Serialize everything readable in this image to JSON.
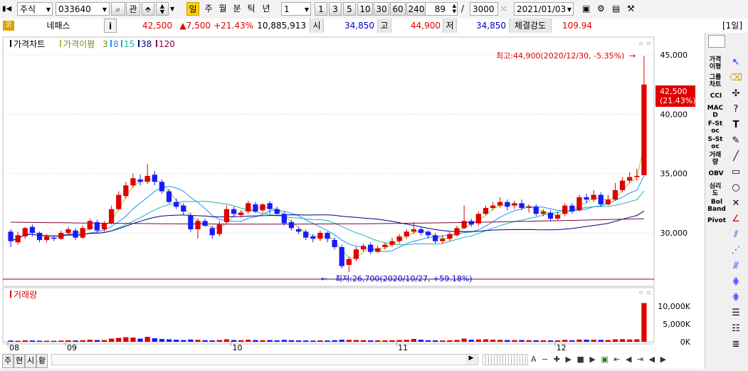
{
  "toolbar": {
    "market": "주식",
    "code": "033640",
    "search_icon": "magnifier-icon",
    "related": "관",
    "periods": [
      "일",
      "주",
      "월",
      "분",
      "틱",
      "년"
    ],
    "selected_period": "일",
    "interval_value": "1",
    "interval_buttons": [
      "1",
      "3",
      "5",
      "10",
      "30",
      "60",
      "240"
    ],
    "count_value": "89",
    "slash": "/",
    "total_count": "3000",
    "date": "2021/01/03"
  },
  "quote": {
    "market_short": "코",
    "name": "네패스",
    "info_label": "i",
    "price": "42,500",
    "change": "▲7,500",
    "change_pct": "+21.43%",
    "volume": "10,885,913",
    "open_label": "시",
    "open": "34,850",
    "high_label": "고",
    "high": "44,900",
    "low_label": "저",
    "low": "34,850",
    "strength_label": "체결강도",
    "strength": "109.94",
    "period_label": "[1일]"
  },
  "legend": {
    "price_chart": "가격차트",
    "ma_label": "가격이평",
    "ma_periods": [
      "3",
      "8",
      "15",
      "38",
      "120"
    ],
    "volume": "거래량"
  },
  "annotations": {
    "high": "최고:44,900(2020/12/30, -5.35%)",
    "low": "최저:26,700(2020/10/27, +59.18%)",
    "current_price": "42,500",
    "current_pct": "(21.43%)"
  },
  "y_axis": {
    "price_ticks": [
      "45,000",
      "40,000",
      "35,000",
      "30,000"
    ],
    "volume_ticks": [
      "10,000K",
      "5,000K",
      "0K"
    ]
  },
  "x_axis": {
    "labels": [
      "08",
      "09",
      "10",
      "11",
      "12"
    ]
  },
  "bottom_tabs": [
    "주",
    "현",
    "시",
    "황"
  ],
  "sidebar": {
    "indicators": [
      "가격이평",
      "그룹차트",
      "CCI",
      "MACD",
      "F-Stoc",
      "S-Stoc",
      "거래량",
      "OBV",
      "심리도",
      "Bol Band",
      "Pivot"
    ],
    "tools": [
      "cursor-icon",
      "eraser-icon",
      "crosshair-icon",
      "help-icon",
      "text-icon",
      "pencil-icon",
      "line-icon",
      "rectangle-icon",
      "circle-icon",
      "cross-icon",
      "angle-icon",
      "fibonacci-icon",
      "gann-icon",
      "channel-icon",
      "grid-icon",
      "stack-icon",
      "list-icon"
    ]
  },
  "colors": {
    "up": "#e00000",
    "down": "#1a1aff",
    "ma3": "#9acd32",
    "ma8": "#1e90ff",
    "ma15": "#20b2aa",
    "ma38": "#00008b",
    "ma120": "#800040"
  },
  "chart_data": {
    "type": "candlestick",
    "title": "가격차트",
    "x_labels": [
      "08",
      "09",
      "10",
      "11",
      "12"
    ],
    "ylim": [
      25500,
      46500
    ],
    "high": 44900,
    "low": 26700,
    "last": 42500,
    "volume_ylim": [
      0,
      12000
    ],
    "volume_unit": "K",
    "candles": [
      [
        30100,
        29300,
        30300,
        28800
      ],
      [
        29200,
        29800,
        30100,
        29000
      ],
      [
        29700,
        30400,
        30500,
        29500
      ],
      [
        30500,
        30000,
        30700,
        29700
      ],
      [
        30000,
        29400,
        30100,
        29200
      ],
      [
        29400,
        29700,
        29900,
        29200
      ],
      [
        29600,
        29500,
        29800,
        29300
      ],
      [
        29500,
        30000,
        30200,
        29400
      ],
      [
        30000,
        30300,
        30500,
        29800
      ],
      [
        30200,
        29600,
        30400,
        29400
      ],
      [
        29600,
        30400,
        30600,
        29500
      ],
      [
        30300,
        31000,
        31200,
        30200
      ],
      [
        30900,
        30200,
        31100,
        30000
      ],
      [
        30300,
        30800,
        31000,
        30100
      ],
      [
        30800,
        32000,
        32300,
        30700
      ],
      [
        32000,
        33200,
        33500,
        31900
      ],
      [
        33100,
        34000,
        34300,
        32900
      ],
      [
        34000,
        34600,
        35000,
        33800
      ],
      [
        34500,
        34300,
        34900,
        34000
      ],
      [
        34300,
        34800,
        35800,
        34100
      ],
      [
        34900,
        34300,
        35200,
        34000
      ],
      [
        34300,
        33500,
        34500,
        33300
      ],
      [
        33500,
        32600,
        33700,
        32500
      ],
      [
        32600,
        32200,
        32900,
        32000
      ],
      [
        32300,
        31800,
        32500,
        31500
      ],
      [
        31500,
        30300,
        31700,
        30100
      ],
      [
        30300,
        31000,
        31200,
        29500
      ],
      [
        31000,
        30600,
        31200,
        30500
      ],
      [
        30400,
        29800,
        30600,
        29500
      ],
      [
        29900,
        30700,
        31000,
        29700
      ],
      [
        30900,
        32000,
        32300,
        30800
      ],
      [
        32000,
        31600,
        32200,
        31300
      ],
      [
        31500,
        31700,
        31900,
        31300
      ],
      [
        31800,
        32500,
        32700,
        31600
      ],
      [
        32400,
        31800,
        32600,
        31700
      ],
      [
        31900,
        32400,
        32500,
        31700
      ],
      [
        32500,
        32000,
        32700,
        31600
      ],
      [
        32000,
        31600,
        32200,
        31400
      ],
      [
        31600,
        30800,
        31800,
        30600
      ],
      [
        30900,
        30400,
        31100,
        30200
      ],
      [
        30300,
        30100,
        30500,
        29900
      ],
      [
        30100,
        29600,
        30300,
        29400
      ],
      [
        29700,
        29500,
        29900,
        29200
      ],
      [
        29500,
        30000,
        30200,
        29300
      ],
      [
        30000,
        29500,
        30100,
        29200
      ],
      [
        29400,
        28800,
        29600,
        28600
      ],
      [
        28800,
        27200,
        29000,
        27000
      ],
      [
        27300,
        27800,
        28000,
        26700
      ],
      [
        27800,
        28600,
        28800,
        27600
      ],
      [
        28600,
        28900,
        29100,
        28400
      ],
      [
        29000,
        28400,
        29200,
        28200
      ],
      [
        28400,
        28700,
        28900,
        28300
      ],
      [
        28800,
        29000,
        29200,
        28600
      ],
      [
        29000,
        29300,
        29600,
        28800
      ],
      [
        29300,
        29700,
        29900,
        29100
      ],
      [
        29700,
        30100,
        30300,
        29500
      ],
      [
        30100,
        30300,
        30900,
        29900
      ],
      [
        30300,
        30000,
        30500,
        29800
      ],
      [
        30100,
        29800,
        30200,
        29500
      ],
      [
        29800,
        29300,
        30000,
        29100
      ],
      [
        29300,
        29500,
        29800,
        29100
      ],
      [
        29500,
        29900,
        30100,
        29300
      ],
      [
        29800,
        30400,
        30600,
        29700
      ],
      [
        30400,
        31000,
        32300,
        30300
      ],
      [
        31000,
        30700,
        31200,
        30500
      ],
      [
        30800,
        31600,
        31800,
        30600
      ],
      [
        31600,
        32100,
        32300,
        31500
      ],
      [
        32100,
        32300,
        32600,
        31900
      ],
      [
        32300,
        32600,
        33000,
        32100
      ],
      [
        32600,
        32200,
        32800,
        31900
      ],
      [
        32300,
        32500,
        32700,
        32000
      ],
      [
        32500,
        32100,
        32800,
        31900
      ],
      [
        32100,
        32200,
        32400,
        31700
      ],
      [
        32200,
        31600,
        32400,
        31400
      ],
      [
        31600,
        31800,
        32000,
        31400
      ],
      [
        31700,
        31200,
        31900,
        31000
      ],
      [
        31200,
        31500,
        31800,
        31000
      ],
      [
        31600,
        32300,
        32500,
        31400
      ],
      [
        32300,
        31800,
        32500,
        31600
      ],
      [
        31900,
        33000,
        33200,
        31800
      ],
      [
        33000,
        32800,
        33300,
        32500
      ],
      [
        32800,
        33200,
        33600,
        32600
      ],
      [
        33200,
        32400,
        33400,
        32200
      ],
      [
        32400,
        32800,
        33200,
        32300
      ],
      [
        32800,
        33600,
        34200,
        32700
      ],
      [
        33600,
        34400,
        34700,
        33400
      ],
      [
        34400,
        34700,
        35100,
        34200
      ],
      [
        34700,
        34800,
        35400,
        34400
      ],
      [
        34850,
        42500,
        44900,
        34850
      ]
    ],
    "volume": [
      350,
      300,
      400,
      380,
      320,
      300,
      280,
      350,
      420,
      380,
      450,
      600,
      500,
      480,
      900,
      1100,
      1300,
      1200,
      900,
      1400,
      1000,
      800,
      700,
      600,
      500,
      650,
      550,
      450,
      400,
      500,
      700,
      500,
      450,
      600,
      500,
      450,
      500,
      420,
      550,
      450,
      400,
      380,
      350,
      400,
      380,
      450,
      600,
      550,
      500,
      450,
      400,
      420,
      400,
      450,
      500,
      550,
      800,
      600,
      450,
      400,
      380,
      420,
      500,
      900,
      600,
      650,
      700,
      600,
      550,
      500,
      480,
      500,
      450,
      450,
      420,
      400,
      400,
      550,
      450,
      650,
      600,
      600,
      550,
      500,
      700,
      750,
      650,
      700,
      10886
    ],
    "ma": [
      {
        "period": 3,
        "color": "#9acd32"
      },
      {
        "period": 8,
        "color": "#1e90ff"
      },
      {
        "period": 15,
        "color": "#20b2aa"
      },
      {
        "period": 38,
        "color": "#00008b"
      },
      {
        "period": 120,
        "color": "#800040"
      }
    ]
  }
}
